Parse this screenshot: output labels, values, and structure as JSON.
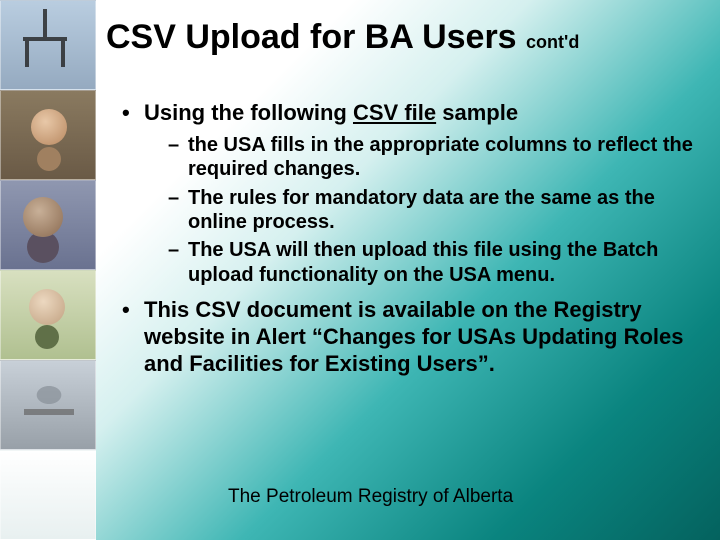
{
  "title": {
    "main": "CSV Upload for BA Users ",
    "suffix": "cont'd"
  },
  "bullets": [
    {
      "pre": "Using the following ",
      "link": "CSV file",
      "post": " sample",
      "sub": [
        "the USA fills in the appropriate columns to reflect the required changes.",
        "The rules for mandatory data are the same as the online process.",
        "The USA will then upload this file using the Batch upload functionality on the USA menu."
      ]
    },
    {
      "text": "This CSV document is available on the Registry website in Alert “Changes for USAs Updating Roles and Facilities for Existing Users”."
    }
  ],
  "footer": "The Petroleum Registry of Alberta"
}
